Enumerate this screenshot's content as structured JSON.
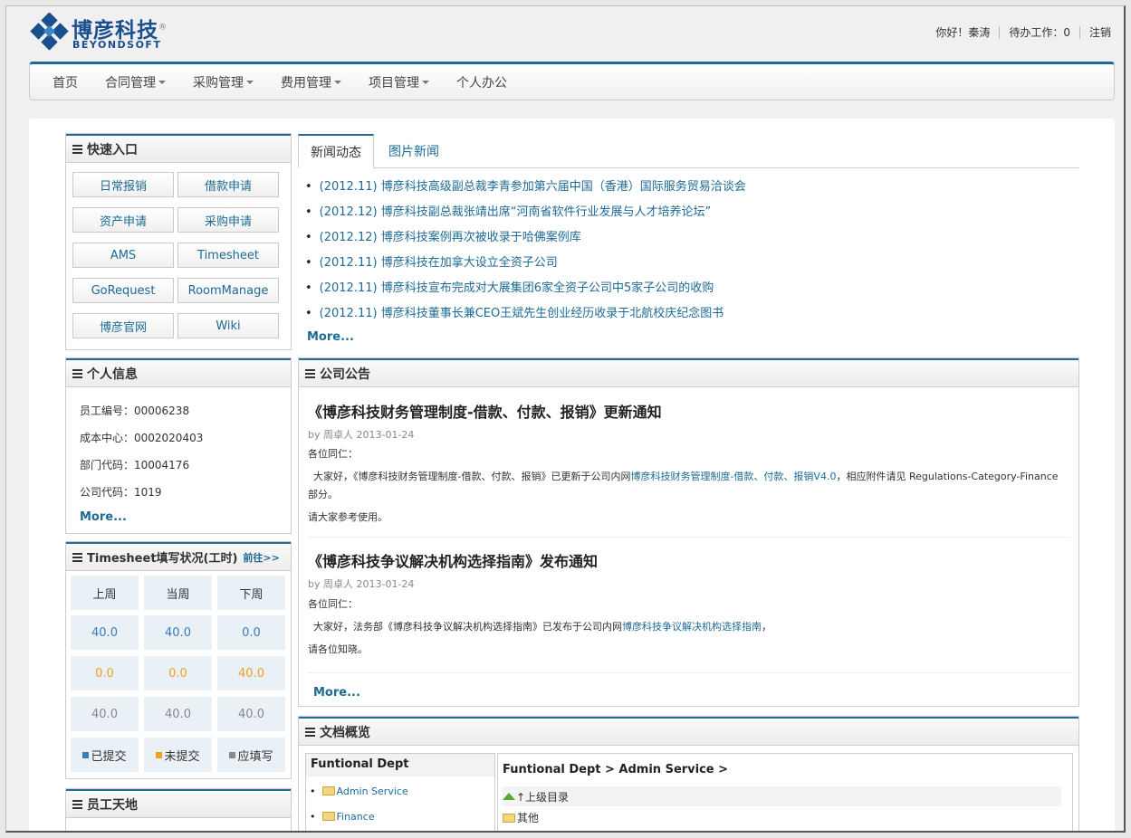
{
  "header": {
    "logo_cn": "博彦科技",
    "logo_mark": "®",
    "logo_en": "BEYONDSOFT",
    "greeting": "你好！秦涛",
    "pending": "待办工作：0",
    "logout": "注销"
  },
  "nav": {
    "items": [
      {
        "label": "首页"
      },
      {
        "label": "合同管理"
      },
      {
        "label": "采购管理"
      },
      {
        "label": "费用管理"
      },
      {
        "label": "项目管理"
      },
      {
        "label": "个人办公"
      }
    ]
  },
  "quick": {
    "title": "快速入口",
    "buttons": [
      "日常报销",
      "借款申请",
      "资产申请",
      "采购申请",
      "AMS",
      "Timesheet",
      "GoRequest",
      "RoomManage",
      "博彦官网",
      "Wiki"
    ]
  },
  "personal": {
    "title": "个人信息",
    "rows": [
      "员工编号：00006238",
      "成本中心：0002020403",
      "部门代码：10004176",
      "公司代码：1019"
    ],
    "more": "More..."
  },
  "timesheet": {
    "title": "Timesheet填写状况(工时)",
    "goto": "前往>>",
    "headers": [
      "上周",
      "当周",
      "下周"
    ],
    "submitted": [
      "40.0",
      "40.0",
      "0.0"
    ],
    "unsubmitted": [
      "0.0",
      "0.0",
      "40.0"
    ],
    "required": [
      "40.0",
      "40.0",
      "40.0"
    ],
    "legend": [
      "已提交",
      "未提交",
      "应填写"
    ],
    "colors": {
      "submitted": "#3a7bbf",
      "unsubmitted": "#f0a020",
      "required": "#888888"
    }
  },
  "staff": {
    "title": "员工天地"
  },
  "newsTabs": {
    "active": "新闻动态",
    "inactive": "图片新闻"
  },
  "news": [
    "(2012.11) 博彦科技高级副总裁李青参加第六届中国（香港）国际服务贸易洽谈会",
    "(2012.12) 博彦科技副总裁张靖出席“河南省软件行业发展与人才培养论坛”",
    "(2012.12) 博彦科技案例再次被收录于哈佛案例库",
    "(2012.11) 博彦科技在加拿大设立全资子公司",
    "(2012.11) 博彦科技宣布完成对大展集团6家全资子公司中5家子公司的收购",
    "(2012.11) 博彦科技董事长兼CEO王斌先生创业经历收录于北航校庆纪念图书"
  ],
  "newsMore": "More...",
  "announce": {
    "title": "公司公告",
    "items": [
      {
        "title": "《博彦科技财务管理制度-借款、付款、报销》更新通知",
        "by": "by 周卓人 2013-01-24",
        "greet": "各位同仁：",
        "body_pre": "大家好，《博彦科技财务管理制度-借款、付款、报销》已更新于公司内网",
        "body_link": "博彦科技财务管理制度-借款、付款、报销V4.0",
        "body_post": "，相应附件请见 Regulations-Category-Finance 部分。",
        "closing": "请大家参考使用。"
      },
      {
        "title": "《博彦科技争议解决机构选择指南》发布通知",
        "by": "by 周卓人 2013-01-24",
        "greet": "各位同仁：",
        "body_pre": "大家好，法务部《博彦科技争议解决机构选择指南》已发布于公司内网",
        "body_link": "博彦科技争议解决机构选择指南",
        "body_post": "，",
        "closing": "请各位知晓。"
      }
    ],
    "more": "More..."
  },
  "docs": {
    "title": "文档概览",
    "tree_title": "Funtional Dept",
    "tree_items": [
      "Admin Service",
      "Finance"
    ],
    "breadcrumb": "Funtional Dept > Admin Service >",
    "up": "↑上级目录",
    "folders": [
      "其他"
    ]
  }
}
